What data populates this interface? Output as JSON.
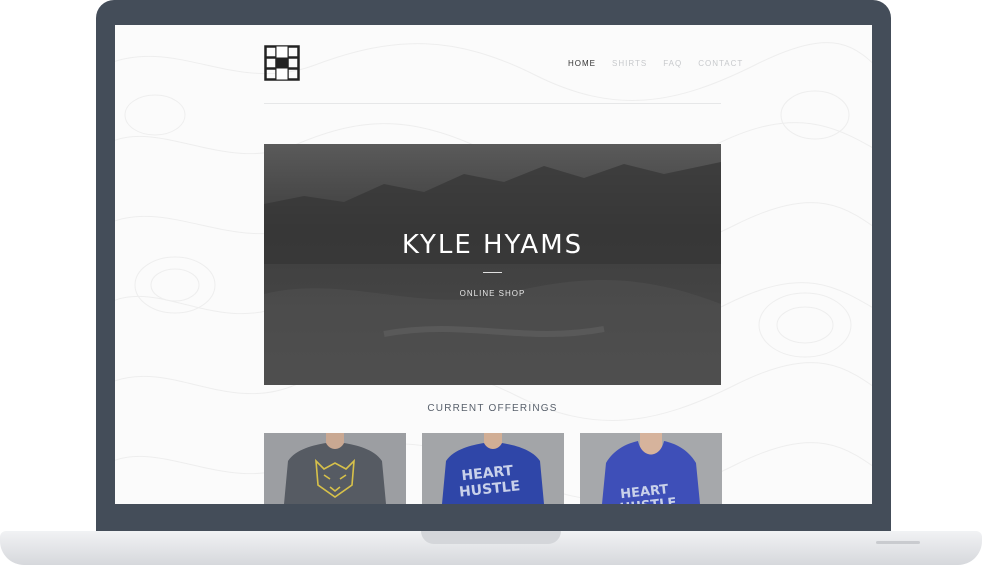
{
  "nav": {
    "items": [
      {
        "label": "HOME",
        "active": true
      },
      {
        "label": "SHIRTS",
        "active": false
      },
      {
        "label": "FAQ",
        "active": false
      },
      {
        "label": "CONTACT",
        "active": false
      }
    ]
  },
  "hero": {
    "title": "KYLE HYAMS",
    "subtitle": "ONLINE SHOP"
  },
  "offerings": {
    "heading": "CURRENT OFFERINGS",
    "products": [
      {
        "shirt_color": "#565b63",
        "graphic": "wolf-head",
        "graphic_color": "#d7c14a"
      },
      {
        "shirt_color": "#2f46a8",
        "graphic": "HEART HUSTLE",
        "graphic_color": "#c9d1ea"
      },
      {
        "shirt_color": "#3e4fb8",
        "graphic": "HEART HUSTLE",
        "graphic_color": "#c9d1ea"
      }
    ]
  },
  "colors": {
    "bezel": "#444d59",
    "screen_bg": "#fbfbfb",
    "hero_bg": "#4a4a4a",
    "text_accent": "#59616c"
  }
}
